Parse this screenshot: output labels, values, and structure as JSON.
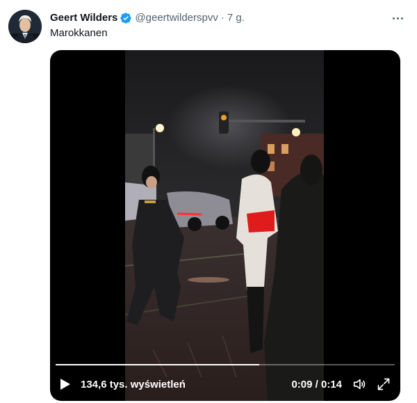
{
  "tweet": {
    "author_name": "Geert Wilders",
    "handle": "@geertwilderspvv",
    "separator": "·",
    "time_ago": "7 g.",
    "text": "Marokkanen",
    "verified": true
  },
  "video": {
    "views": "134,6 tys. wyświetleń",
    "time_readout": "0:09 / 0:14",
    "progress": 0.6
  },
  "colors": {
    "verified_blue": "#1d9bf0",
    "text_primary": "#0f1419",
    "text_secondary": "#536471"
  },
  "icons": {
    "verified": "verified-badge-icon",
    "more": "more-options-icon",
    "play": "play-icon",
    "volume": "volume-icon",
    "fullscreen": "fullscreen-icon"
  }
}
